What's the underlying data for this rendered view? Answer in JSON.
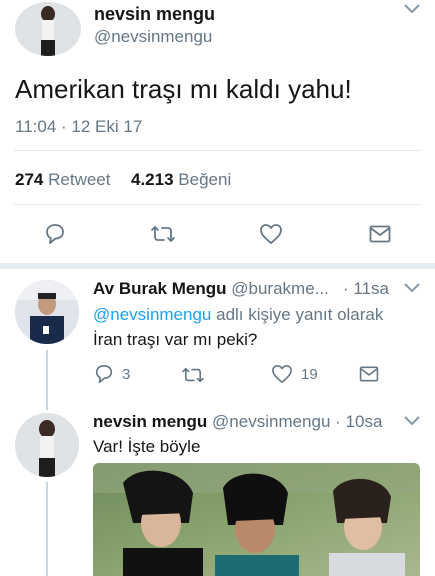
{
  "main_tweet": {
    "display_name": "nevsin mengu",
    "handle": "@nevsinmengu",
    "text": "Amerikan traşı mı kaldı yahu!",
    "timestamp": "11:04 · 12 Eki 17",
    "retweet_count": "274",
    "retweet_label": "Retweet",
    "like_count": "4.213",
    "like_label": "Beğeni"
  },
  "reply_1": {
    "display_name": "Av Burak Mengu",
    "handle": "@burakme...",
    "time": "· 11sa",
    "reply_to_user": "@nevsinmengu",
    "reply_to_suffix": "adlı kişiye yanıt olarak",
    "text": "İran traşı var mı peki?",
    "reply_count": "3",
    "like_count": "19"
  },
  "reply_2": {
    "display_name": "nevsin mengu",
    "handle": "@nevsinmengu",
    "time": "· 10sa",
    "text": "Var! İşte böyle"
  },
  "colors": {
    "accent": "#1da1f2",
    "muted": "#657786",
    "text": "#14171a",
    "divider": "#e1e8ed"
  }
}
